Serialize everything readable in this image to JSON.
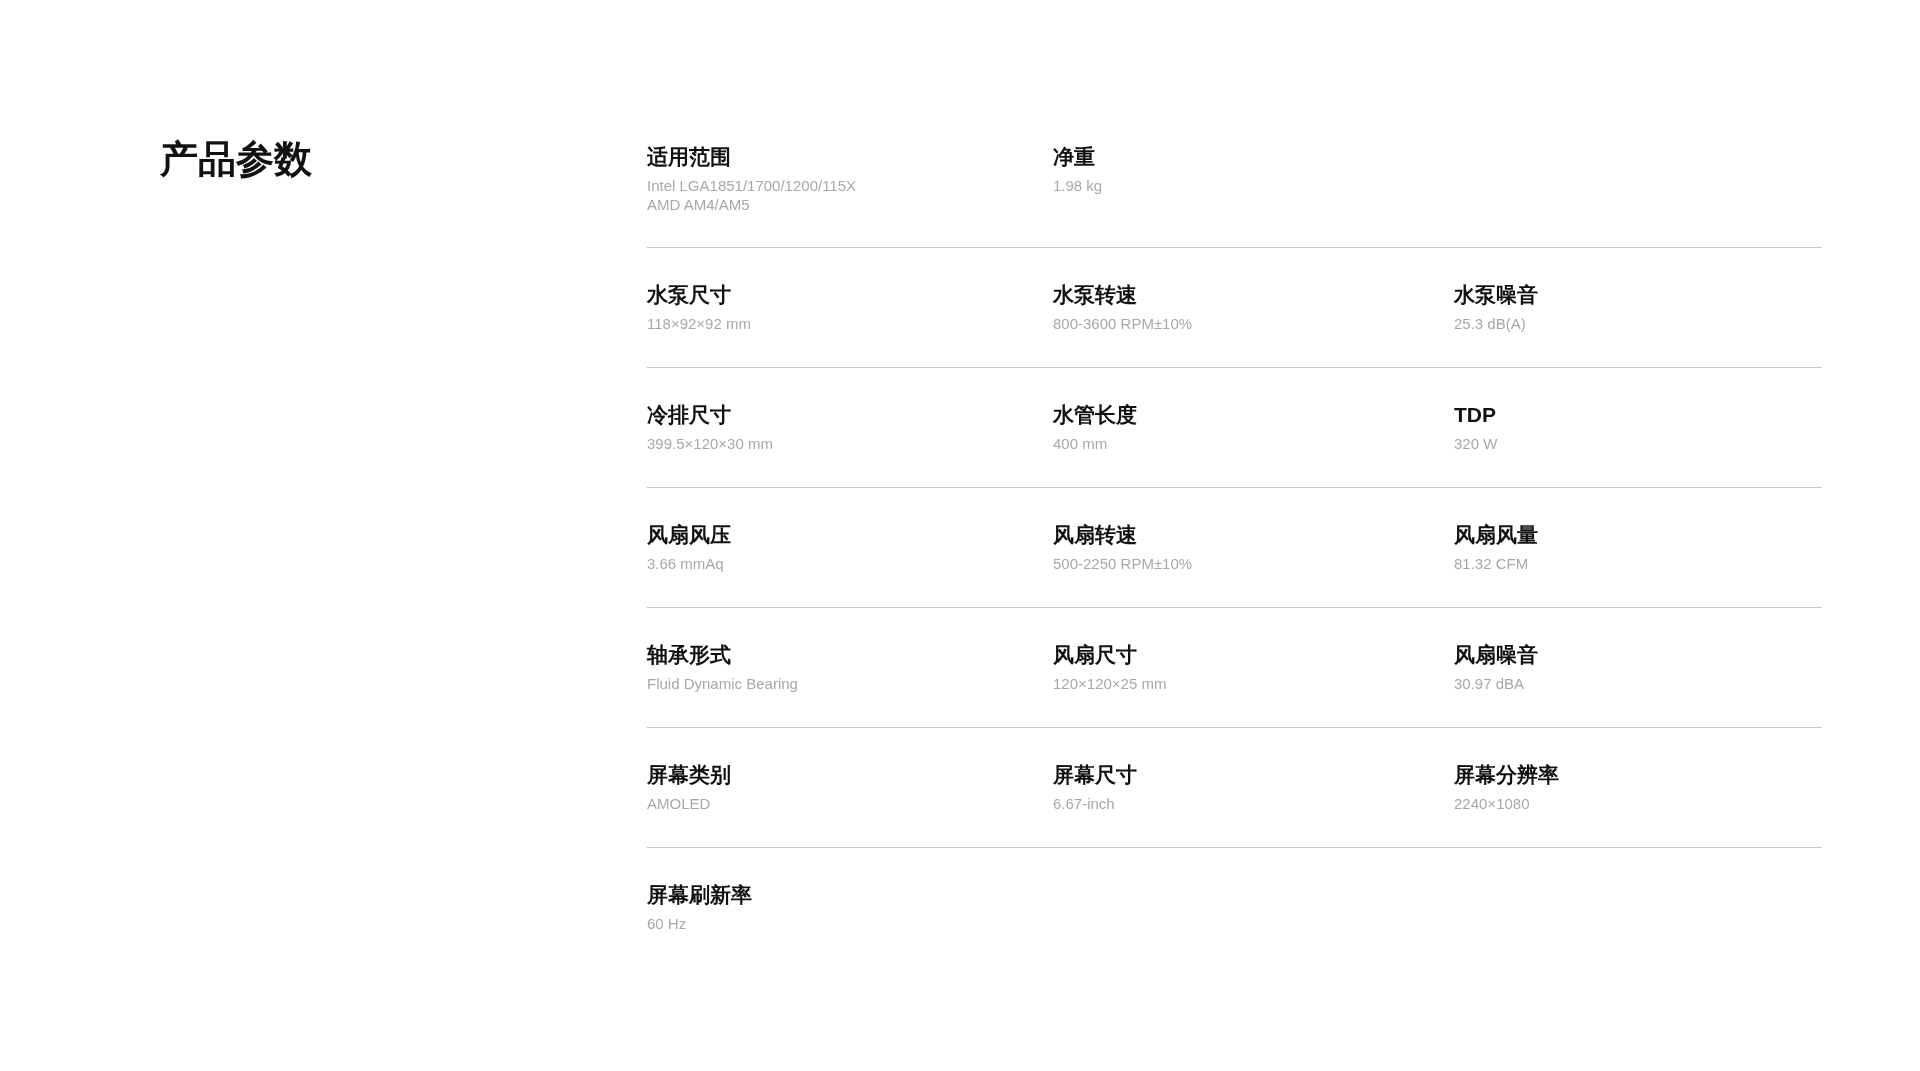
{
  "title": "产品参数",
  "spec_rows": [
    [
      {
        "label": "适用范围",
        "value_lines": [
          "Intel LGA1851/1700/1200/115X",
          "AMD AM4/AM5"
        ]
      },
      {
        "label": "净重",
        "value_lines": [
          "1.98 kg"
        ]
      }
    ],
    [
      {
        "label": "水泵尺寸",
        "value_lines": [
          "118×92×92 mm"
        ]
      },
      {
        "label": "水泵转速",
        "value_lines": [
          "800-3600 RPM±10%"
        ]
      },
      {
        "label": "水泵噪音",
        "value_lines": [
          "25.3 dB(A)"
        ]
      }
    ],
    [
      {
        "label": "冷排尺寸",
        "value_lines": [
          "399.5×120×30 mm"
        ]
      },
      {
        "label": "水管长度",
        "value_lines": [
          "400 mm"
        ]
      },
      {
        "label": "TDP",
        "value_lines": [
          "320 W"
        ]
      }
    ],
    [
      {
        "label": "风扇风压",
        "value_lines": [
          "3.66 mmAq"
        ]
      },
      {
        "label": "风扇转速",
        "value_lines": [
          "500-2250 RPM±10%"
        ]
      },
      {
        "label": "风扇风量",
        "value_lines": [
          "81.32 CFM"
        ]
      }
    ],
    [
      {
        "label": "轴承形式",
        "value_lines": [
          "Fluid Dynamic Bearing"
        ]
      },
      {
        "label": "风扇尺寸",
        "value_lines": [
          "120×120×25 mm"
        ]
      },
      {
        "label": "风扇噪音",
        "value_lines": [
          "30.97 dBA"
        ]
      }
    ],
    [
      {
        "label": "屏幕类别",
        "value_lines": [
          "AMOLED"
        ]
      },
      {
        "label": "屏幕尺寸",
        "value_lines": [
          "6.67-inch"
        ]
      },
      {
        "label": "屏幕分辨率",
        "value_lines": [
          "2240×1080"
        ]
      }
    ],
    [
      {
        "label": "屏幕刷新率",
        "value_lines": [
          "60 Hz"
        ]
      }
    ]
  ]
}
